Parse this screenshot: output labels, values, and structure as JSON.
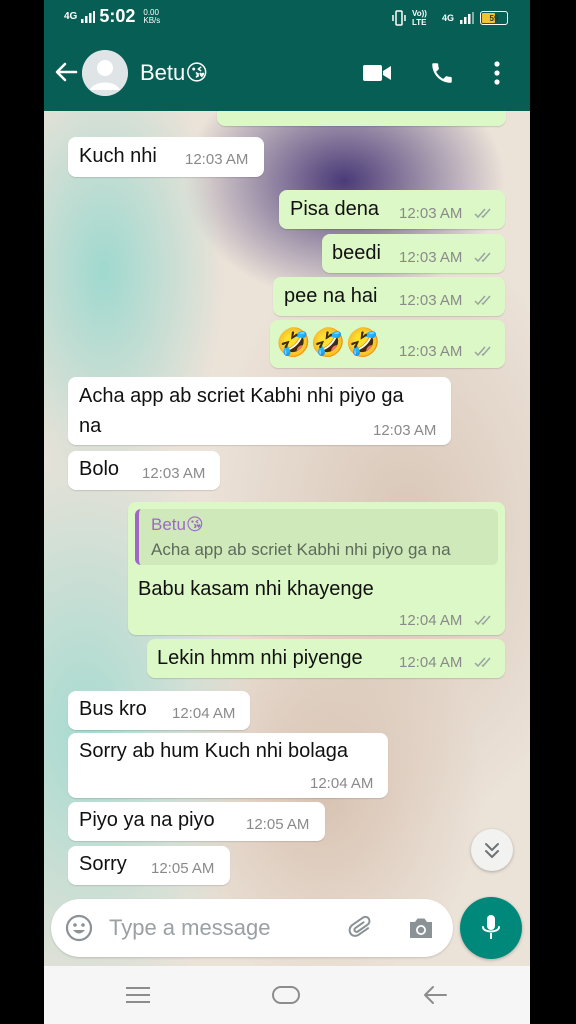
{
  "status_bar": {
    "network": "4G",
    "time": "5:02",
    "data_speed": "0.00",
    "data_unit": "KB/s",
    "volte": "Vo)) LTE",
    "network_right": "4G",
    "battery": "59"
  },
  "header": {
    "contact_name": "Betu😘"
  },
  "messages": [
    {
      "text": "Kuch nhi",
      "time": "12:03 AM"
    },
    {
      "text": "Pisa dena",
      "time": "12:03 AM"
    },
    {
      "text": "beedi",
      "time": "12:03 AM"
    },
    {
      "text": "pee na hai",
      "time": "12:03 AM"
    },
    {
      "text": "🤣🤣🤣",
      "time": "12:03 AM"
    },
    {
      "text_line1": "Acha app ab scriet Kabhi nhi piyo ga",
      "text_line2": "na",
      "time": "12:03 AM"
    },
    {
      "text": "Bolo",
      "time": "12:03 AM"
    },
    {
      "quote_name": "Betu😘",
      "quote_text": "Acha app ab scriet Kabhi nhi piyo ga na",
      "text": "Babu kasam nhi khayenge",
      "time": "12:04 AM"
    },
    {
      "text": "Lekin hmm nhi piyenge",
      "time": "12:04 AM"
    },
    {
      "text": "Bus kro",
      "time": "12:04 AM"
    },
    {
      "text": "Sorry ab hum Kuch nhi bolaga",
      "time": "12:04 AM"
    },
    {
      "text": "Piyo ya na piyo",
      "time": "12:05 AM"
    },
    {
      "text": "Sorry",
      "time": "12:05 AM"
    }
  ],
  "composer": {
    "placeholder": "Type a message"
  },
  "colors": {
    "header": "#075e54",
    "outgoing_bubble": "#dcf8c6",
    "incoming_bubble": "#ffffff",
    "mic_button": "#00897b"
  },
  "icons": [
    "back-arrow-icon",
    "avatar",
    "video-call-icon",
    "phone-icon",
    "more-vert-icon",
    "double-check-icon",
    "chevron-double-down-icon",
    "emoji-icon",
    "attach-icon",
    "camera-icon",
    "mic-icon",
    "nav-menu-icon",
    "nav-home-icon",
    "nav-back-icon"
  ]
}
